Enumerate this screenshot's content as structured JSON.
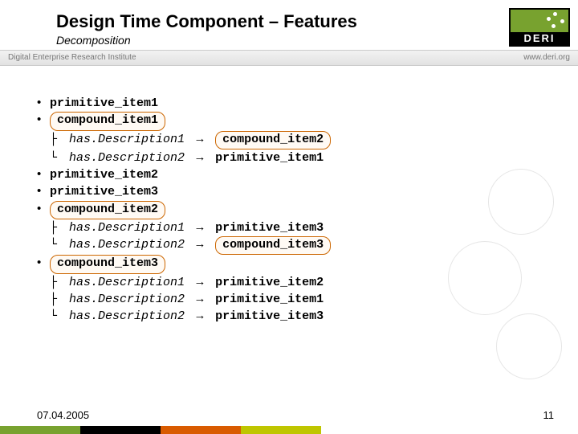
{
  "header": {
    "title": "Design Time Component – Features",
    "subtitle": "Decomposition"
  },
  "metabar": {
    "left": "Digital Enterprise Research Institute",
    "right": "www.deri.org"
  },
  "logo": {
    "text": "DERI"
  },
  "items": [
    {
      "kind": "bullet",
      "label": "primitive_item1",
      "boxed": false
    },
    {
      "kind": "bullet",
      "label": "compound_item1",
      "boxed": true
    },
    {
      "kind": "desc",
      "tree": "├",
      "label": "has.Description1",
      "arrow": "→",
      "target": "compound_item2",
      "targetBoxed": true
    },
    {
      "kind": "desc",
      "tree": "└",
      "label": "has.Description2",
      "arrow": "→",
      "target": "primitive_item1",
      "targetBoxed": false
    },
    {
      "kind": "bullet",
      "label": "primitive_item2",
      "boxed": false
    },
    {
      "kind": "bullet",
      "label": "primitive_item3",
      "boxed": false
    },
    {
      "kind": "bullet",
      "label": "compound_item2",
      "boxed": true
    },
    {
      "kind": "desc",
      "tree": "├",
      "label": "has.Description1",
      "arrow": "→",
      "target": "primitive_item3",
      "targetBoxed": false
    },
    {
      "kind": "desc",
      "tree": "└",
      "label": "has.Description2",
      "arrow": "→",
      "target": "compound_item3",
      "targetBoxed": true
    },
    {
      "kind": "bullet",
      "label": "compound_item3",
      "boxed": true
    },
    {
      "kind": "desc",
      "tree": "├",
      "label": "has.Description1",
      "arrow": "→",
      "target": "primitive_item2",
      "targetBoxed": false
    },
    {
      "kind": "desc",
      "tree": "├",
      "label": "has.Description2",
      "arrow": "→",
      "target": "primitive_item1",
      "targetBoxed": false
    },
    {
      "kind": "desc",
      "tree": "└",
      "label": "has.Description2",
      "arrow": "→",
      "target": "primitive_item3",
      "targetBoxed": false
    }
  ],
  "footer": {
    "date": "07.04.2005",
    "page": "11"
  }
}
